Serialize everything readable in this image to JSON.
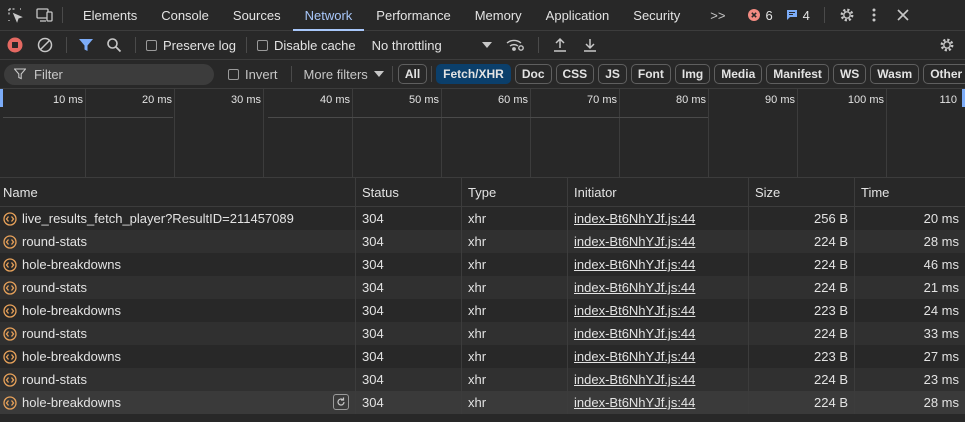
{
  "tabs": [
    "Elements",
    "Console",
    "Sources",
    "Network",
    "Performance",
    "Memory",
    "Application",
    "Security"
  ],
  "more_tabs": ">>",
  "error_count": "6",
  "message_count": "4",
  "toolbar": {
    "preserve_log": "Preserve log",
    "disable_cache": "Disable cache",
    "throttling": "No throttling"
  },
  "filter": {
    "placeholder": "Filter",
    "invert": "Invert",
    "more_filters": "More filters",
    "types": [
      "All",
      "Fetch/XHR",
      "Doc",
      "CSS",
      "JS",
      "Font",
      "Img",
      "Media",
      "Manifest",
      "WS",
      "Wasm",
      "Other"
    ],
    "active_type": "Fetch/XHR"
  },
  "timeline": {
    "ticks": [
      "10 ms",
      "20 ms",
      "30 ms",
      "40 ms",
      "50 ms",
      "60 ms",
      "70 ms",
      "80 ms",
      "90 ms",
      "100 ms",
      "110"
    ]
  },
  "columns": [
    "Name",
    "Status",
    "Type",
    "Initiator",
    "Size",
    "Time"
  ],
  "rows": [
    {
      "name": "live_results_fetch_player?ResultID=211457089",
      "status": "304",
      "type": "xhr",
      "initiator": "index-Bt6NhYJf.js:44",
      "size": "256 B",
      "time": "20 ms"
    },
    {
      "name": "round-stats",
      "status": "304",
      "type": "xhr",
      "initiator": "index-Bt6NhYJf.js:44",
      "size": "224 B",
      "time": "28 ms"
    },
    {
      "name": "hole-breakdowns",
      "status": "304",
      "type": "xhr",
      "initiator": "index-Bt6NhYJf.js:44",
      "size": "224 B",
      "time": "46 ms"
    },
    {
      "name": "round-stats",
      "status": "304",
      "type": "xhr",
      "initiator": "index-Bt6NhYJf.js:44",
      "size": "224 B",
      "time": "21 ms"
    },
    {
      "name": "hole-breakdowns",
      "status": "304",
      "type": "xhr",
      "initiator": "index-Bt6NhYJf.js:44",
      "size": "223 B",
      "time": "24 ms"
    },
    {
      "name": "round-stats",
      "status": "304",
      "type": "xhr",
      "initiator": "index-Bt6NhYJf.js:44",
      "size": "224 B",
      "time": "33 ms"
    },
    {
      "name": "hole-breakdowns",
      "status": "304",
      "type": "xhr",
      "initiator": "index-Bt6NhYJf.js:44",
      "size": "223 B",
      "time": "27 ms"
    },
    {
      "name": "round-stats",
      "status": "304",
      "type": "xhr",
      "initiator": "index-Bt6NhYJf.js:44",
      "size": "224 B",
      "time": "23 ms"
    },
    {
      "name": "hole-breakdowns",
      "status": "304",
      "type": "xhr",
      "initiator": "index-Bt6NhYJf.js:44",
      "size": "224 B",
      "time": "28 ms"
    }
  ],
  "icons": {
    "inspect": "inspect-element-icon",
    "device": "device-toolbar-icon",
    "error": "error-icon",
    "message": "message-icon",
    "settings": "gear-icon",
    "menu": "kebab-menu-icon",
    "close": "close-icon",
    "record": "stop-recording-icon",
    "clear": "clear-icon",
    "filter": "filter-icon",
    "search": "search-icon",
    "network_conditions": "network-conditions-icon",
    "import": "import-har-icon",
    "export": "export-har-icon",
    "xhr": "xhr-request-icon",
    "replay": "replay-xhr-icon"
  },
  "colors": {
    "accent": "#a8c7fa",
    "error": "#f28b82",
    "record": "#e46962",
    "filter_active": "#7cacf8",
    "xhr_icon": "#e8a25a",
    "chip_active_bg": "#0b3f6b"
  }
}
